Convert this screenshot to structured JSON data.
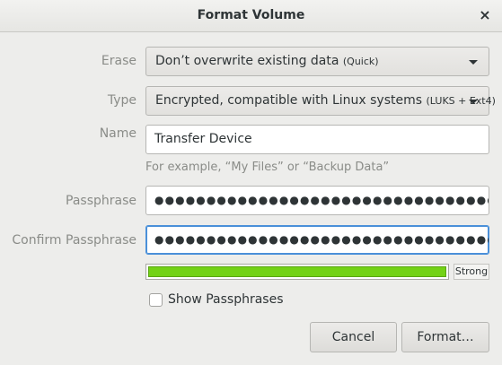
{
  "window": {
    "title": "Format Volume",
    "close_glyph": "×"
  },
  "erase": {
    "label": "Erase",
    "value": "Don’t overwrite existing data",
    "qualifier": "(Quick)"
  },
  "type": {
    "label": "Type",
    "value": "Encrypted, compatible with Linux systems",
    "qualifier": "(LUKS + Ext4)"
  },
  "name": {
    "label": "Name",
    "value": "Transfer Device",
    "hint": "For example, “My Files” or “Backup Data”"
  },
  "passphrase": {
    "label": "Passphrase",
    "masked": "●●●●●●●●●●●●●●●●●●●●●●●●●●●●●●●●●●●●●"
  },
  "confirm": {
    "label": "Confirm Passphrase",
    "masked": "●●●●●●●●●●●●●●●●●●●●●●●●●●●●●●●●●●●●●"
  },
  "strength": {
    "label": "Strong",
    "level": 1.0,
    "color": "#73d216"
  },
  "show_passphrases": {
    "label": "Show Passphrases",
    "checked": false
  },
  "buttons": {
    "cancel": "Cancel",
    "format": "Format…"
  },
  "icons": {
    "close": "close-icon",
    "dropdown": "chevron-down-icon"
  }
}
